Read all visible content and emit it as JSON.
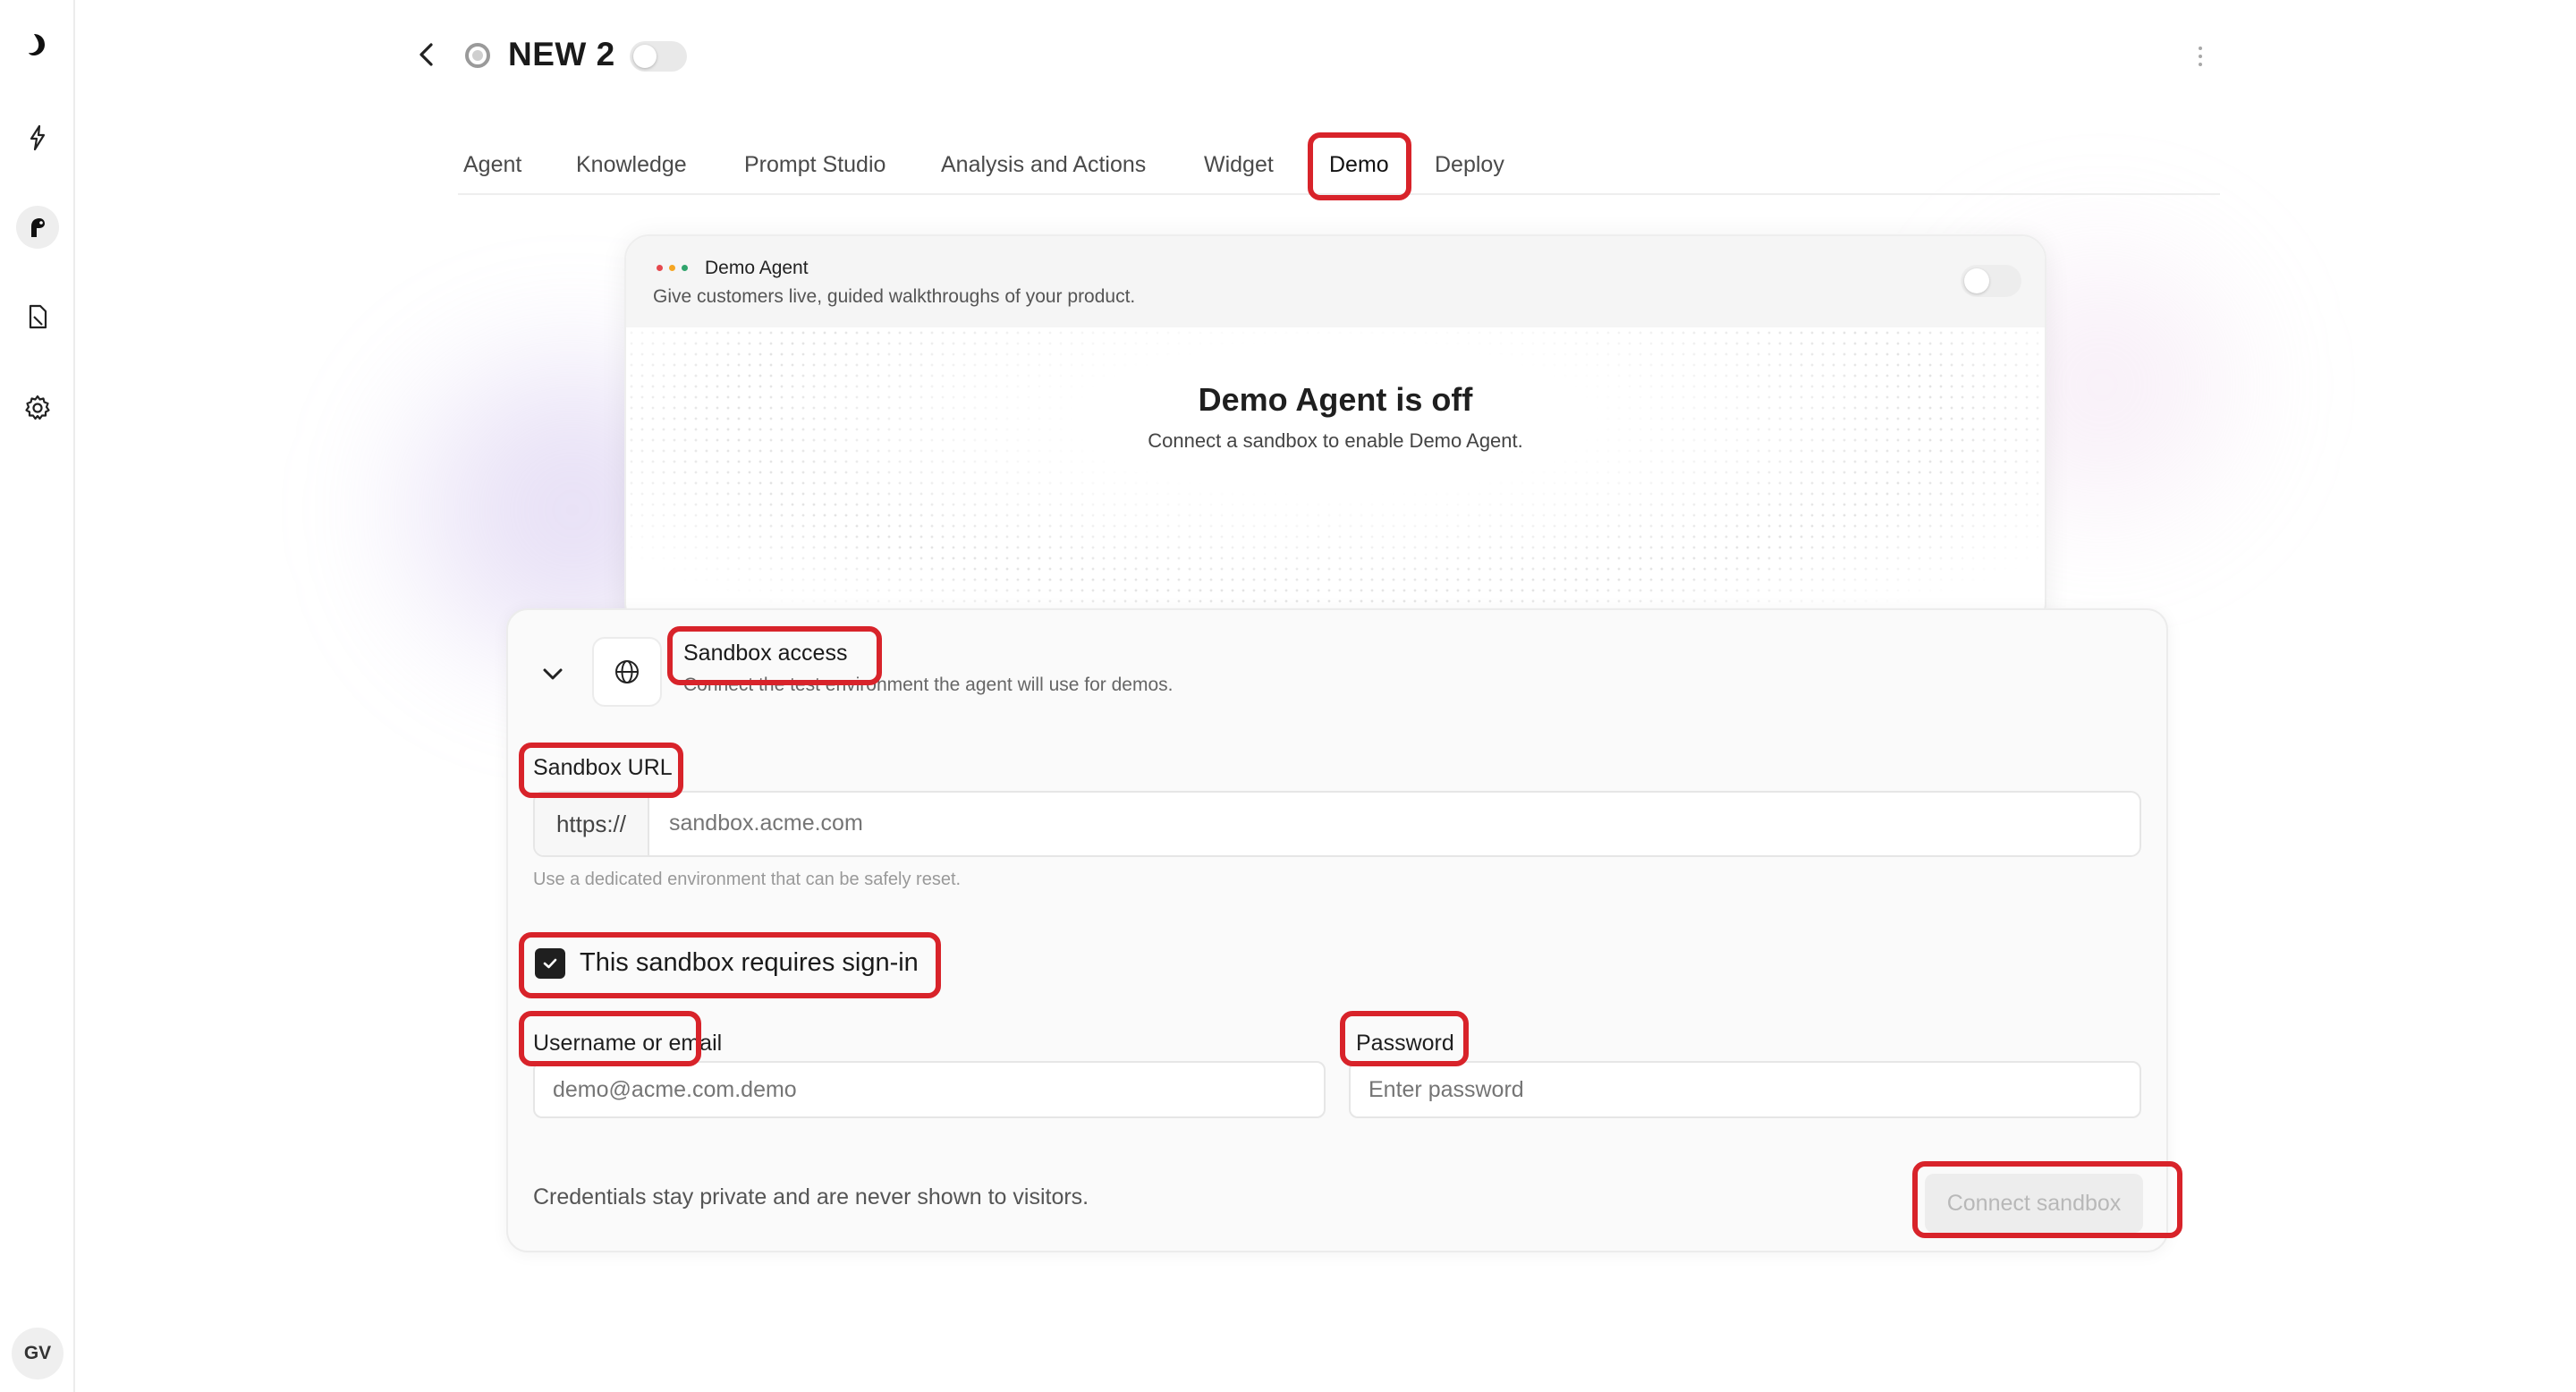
{
  "header": {
    "title": "NEW 2",
    "back_label": "",
    "more_label": ""
  },
  "tabs": [
    {
      "label": "Agent"
    },
    {
      "label": "Knowledge"
    },
    {
      "label": "Prompt Studio"
    },
    {
      "label": "Analysis and Actions"
    },
    {
      "label": "Widget"
    },
    {
      "label": "Demo",
      "active": true
    },
    {
      "label": "Deploy"
    }
  ],
  "demo_card": {
    "title": "Demo Agent",
    "subtitle": "Give customers live, guided walkthroughs of your product.",
    "state_title": "Demo Agent is off",
    "state_subtitle": "Connect a sandbox to enable Demo Agent.",
    "dot_colors": [
      "#e5484d",
      "#f5a623",
      "#30a46c"
    ]
  },
  "sandbox": {
    "title": "Sandbox access",
    "subtitle": "Connect the test environment the agent will use for demos.",
    "url_label": "Sandbox URL",
    "url_prefix": "https://",
    "url_placeholder": "sandbox.acme.com",
    "url_helper": "Use a dedicated environment that can be safely reset.",
    "signin_checkbox_label": "This sandbox requires sign-in",
    "signin_checked": true,
    "username_label": "Username or email",
    "username_placeholder": "demo@acme.com.demo",
    "password_label": "Password",
    "password_placeholder": "Enter password",
    "footnote": "Credentials stay private and are never shown to visitors.",
    "connect_label": "Connect sandbox"
  },
  "user": {
    "initials": "GV"
  },
  "sidebar": {
    "icons": [
      "logo-icon",
      "agents-icon",
      "assistant-icon",
      "documents-icon",
      "settings-icon"
    ]
  },
  "colors": {
    "highlight": "#d8232a",
    "accent_dark": "#1f1f1f"
  }
}
